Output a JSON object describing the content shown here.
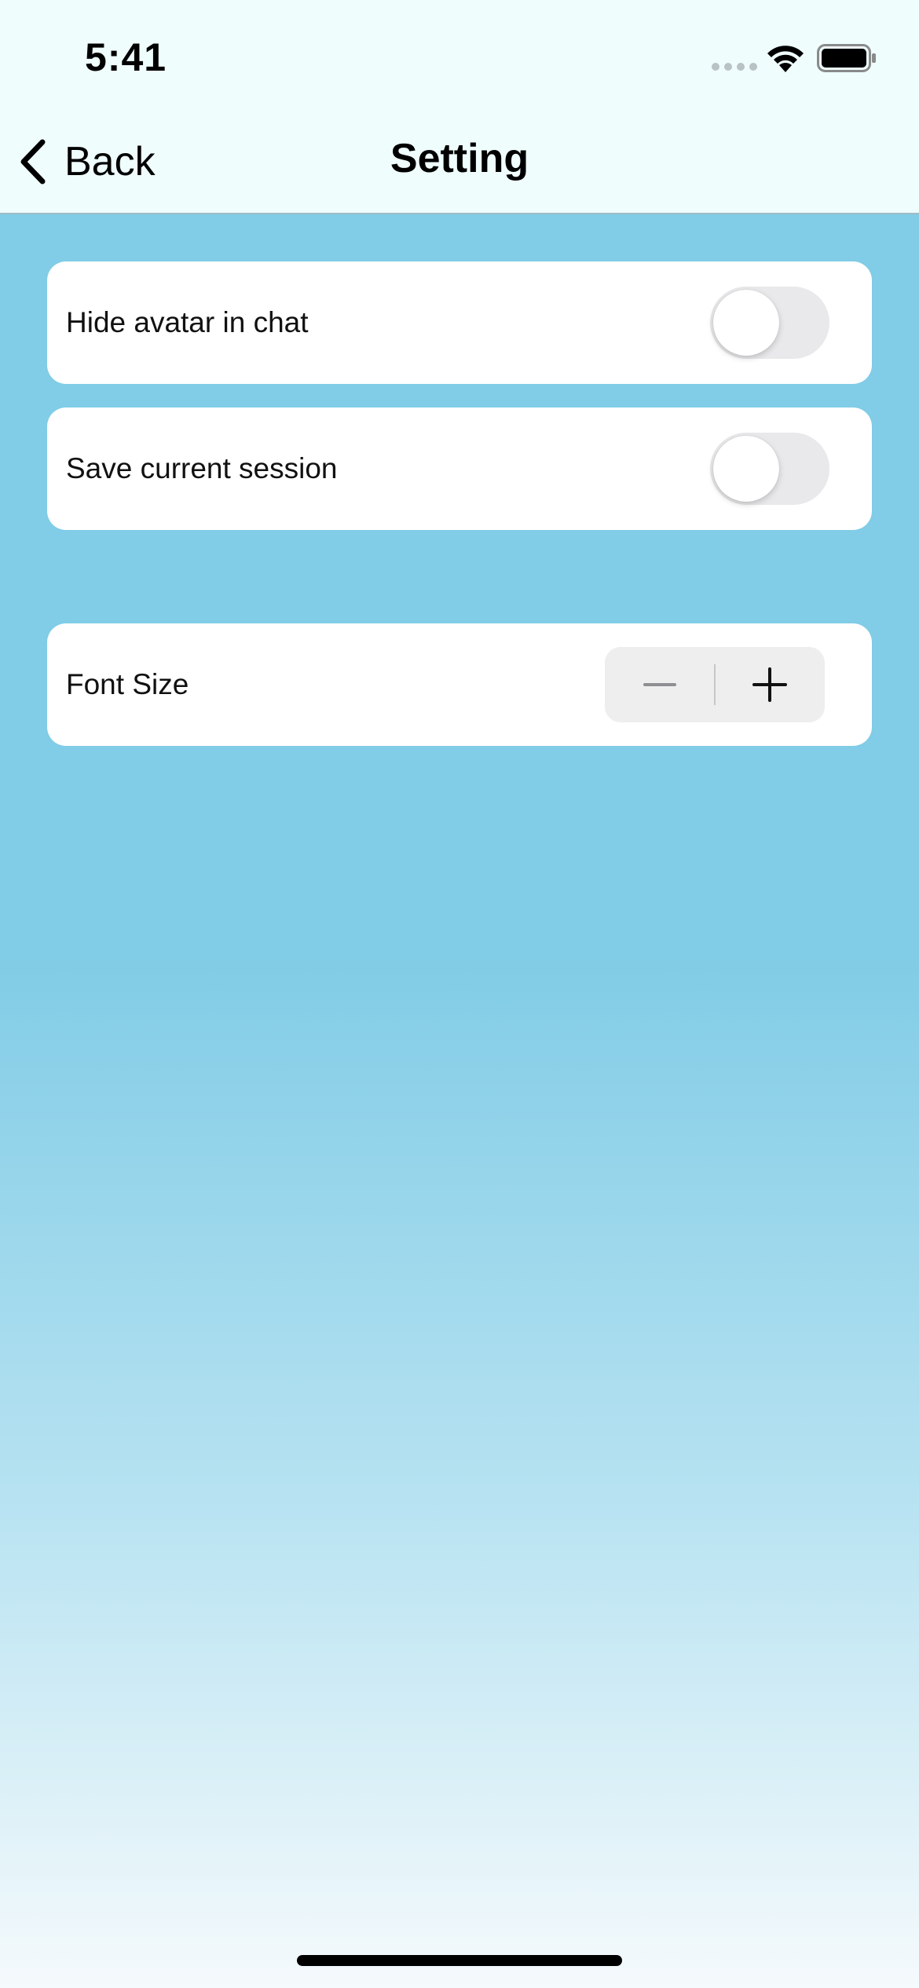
{
  "status_bar": {
    "time": "5:41",
    "icons": [
      "cellular-signal-icon",
      "wifi-icon",
      "battery-icon"
    ]
  },
  "nav": {
    "back_label": "Back",
    "title": "Setting"
  },
  "settings": {
    "items": [
      {
        "label": "Hide avatar in chat",
        "control": "toggle",
        "on": false
      },
      {
        "label": "Save current session",
        "control": "toggle",
        "on": false
      },
      {
        "label": "Font Size",
        "control": "stepper"
      }
    ]
  },
  "colors": {
    "background_top": "#81cce6",
    "background_bottom": "#f5fafc",
    "nav_background": "#effdfd",
    "card": "#ffffff",
    "toggle_off": "#e9e9eb"
  }
}
